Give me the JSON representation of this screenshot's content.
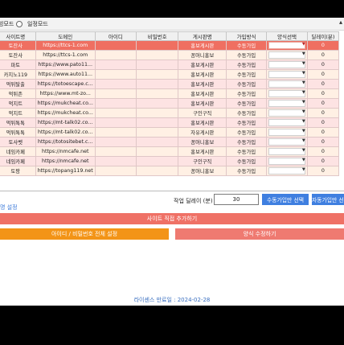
{
  "modes": {
    "left_label": "빙모드",
    "right_label": "일정모드"
  },
  "table": {
    "columns": [
      "사이트명",
      "도메인",
      "아이디",
      "비밀번호",
      "게시판명",
      "가입방식",
      "양식선택",
      "딜레이(분)"
    ],
    "rows": [
      {
        "site": "토잔사",
        "domain": "https://ttcs-1.com",
        "id": "",
        "pw": "",
        "board": "홍보게시판",
        "join": "수동가입",
        "form": "",
        "delay": "0"
      },
      {
        "site": "토잔사",
        "domain": "https://ttcs-1.com",
        "id": "",
        "pw": "",
        "board": "꽁머니홍보",
        "join": "수동가입",
        "form": "",
        "delay": "0"
      },
      {
        "site": "파토",
        "domain": "https://www.pato11...",
        "id": "",
        "pw": "",
        "board": "홍보게시판",
        "join": "수동가입",
        "form": "",
        "delay": "0"
      },
      {
        "site": "카지노119",
        "domain": "https://www.auto11...",
        "id": "",
        "pw": "",
        "board": "홍보게시판",
        "join": "수동가입",
        "form": "",
        "delay": "0"
      },
      {
        "site": "먹튀탈출",
        "domain": "https://totoescape.c...",
        "id": "",
        "pw": "",
        "board": "홍보게시판",
        "join": "수동가입",
        "form": "",
        "delay": "0"
      },
      {
        "site": "먹튀존",
        "domain": "https://www.mt-zo...",
        "id": "",
        "pw": "",
        "board": "홍보게시판",
        "join": "수동가입",
        "form": "",
        "delay": "0"
      },
      {
        "site": "먹지트",
        "domain": "https://mukcheat.co...",
        "id": "",
        "pw": "",
        "board": "홍보게시판",
        "join": "수동가입",
        "form": "",
        "delay": "0"
      },
      {
        "site": "먹지트",
        "domain": "https://mukcheat.co...",
        "id": "",
        "pw": "",
        "board": "구인구직",
        "join": "수동가입",
        "form": "",
        "delay": "0"
      },
      {
        "site": "먹튀톡톡",
        "domain": "https://mt-talk02.co...",
        "id": "",
        "pw": "",
        "board": "홍보게시판",
        "join": "수동가입",
        "form": "",
        "delay": "0"
      },
      {
        "site": "먹튀톡톡",
        "domain": "https://mt-talk02.co...",
        "id": "",
        "pw": "",
        "board": "자유게시판",
        "join": "수동가입",
        "form": "",
        "delay": "0"
      },
      {
        "site": "토사벳",
        "domain": "https://totositebet.c...",
        "id": "",
        "pw": "",
        "board": "꽁머니홍보",
        "join": "수동가입",
        "form": "",
        "delay": "0"
      },
      {
        "site": "네임카페",
        "domain": "https://nmcafe.net",
        "id": "",
        "pw": "",
        "board": "홍보게시판",
        "join": "수동가입",
        "form": "",
        "delay": "0"
      },
      {
        "site": "네임카페",
        "domain": "https://nmcafe.net",
        "id": "",
        "pw": "",
        "board": "구인구직",
        "join": "수동가입",
        "form": "",
        "delay": "0"
      },
      {
        "site": "토팡",
        "domain": "https://topang119.net",
        "id": "",
        "pw": "",
        "board": "꽁머니홍보",
        "join": "수동가입",
        "form": "",
        "delay": "0"
      }
    ]
  },
  "section_label": "명 설정",
  "delay": {
    "label": "작업 딜레이 (분)",
    "value": "30"
  },
  "buttons": {
    "manual_join": "수동가입만 선택",
    "auto_join": "자동가입만 선택",
    "add_site": "사이트 직접 추가하기",
    "bulk_set": "아이디 / 비밀번호 전체 설정",
    "edit_form": "양식 수정하기"
  },
  "license": "라이센스 만료일 : 2024-02-28",
  "colors": {
    "selected_row": "#ef6f61",
    "row_pink": "#fde3e3",
    "row_peach": "#fff0e4",
    "blue_button": "#3f7fe0",
    "orange_button": "#f39417",
    "coral_button": "#ef7a71"
  }
}
